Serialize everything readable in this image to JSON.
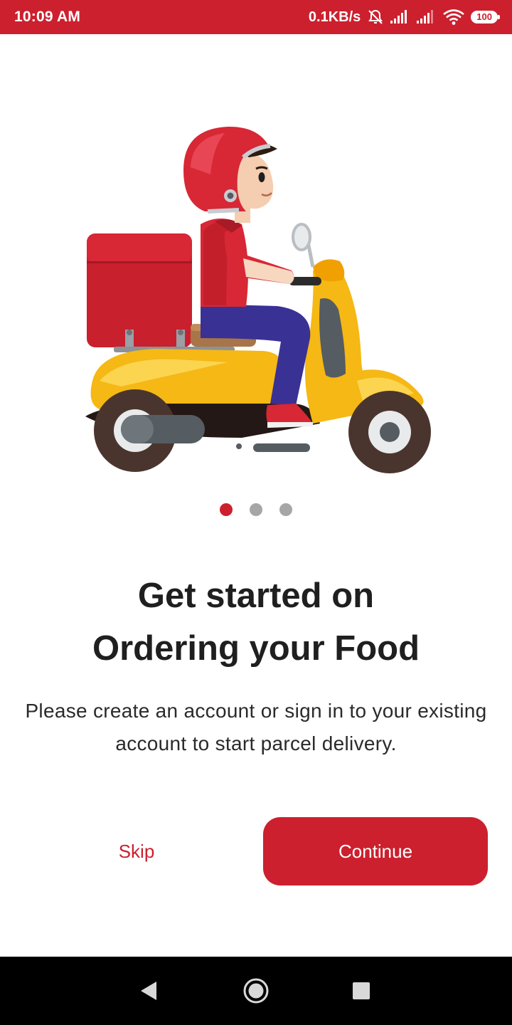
{
  "status_bar": {
    "time": "10:09 AM",
    "network_speed": "0.1KB/s",
    "battery_level": "100",
    "icons": [
      "alarm-off-icon",
      "signal-icon",
      "signal-icon",
      "wifi-icon",
      "battery-icon"
    ]
  },
  "hero": {
    "icon": "delivery-scooter-illustration"
  },
  "pagination": {
    "total": 3,
    "active_index": 0
  },
  "onboarding": {
    "title_line1": "Get started on",
    "title_line2": "Ordering your Food",
    "description": "Please create an account or sign in to your existing account to start parcel delivery."
  },
  "actions": {
    "skip_label": "Skip",
    "continue_label": "Continue"
  },
  "navigation": {
    "icons": [
      "back-icon",
      "home-icon",
      "recents-icon"
    ]
  },
  "colors": {
    "primary": "#cc202e",
    "text_dark": "#1f1f1f",
    "dot_inactive": "#a6a6a6"
  }
}
